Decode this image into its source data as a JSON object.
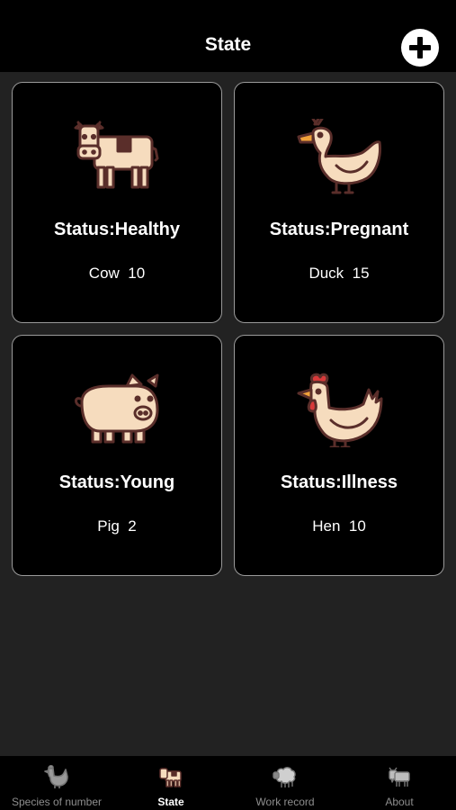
{
  "header": {
    "title": "State"
  },
  "colors": {
    "background": "#222222",
    "card_background": "#000000",
    "card_border": "#9a9a9a",
    "animal_fill": "#f6dcbe",
    "animal_outline": "#5a2e2a",
    "comb_red": "#d83a3a",
    "beak_orange": "#f2a23a"
  },
  "cards": [
    {
      "icon": "cow-icon",
      "status": "Status:Healthy",
      "animal": "Cow",
      "count": "10"
    },
    {
      "icon": "duck-icon",
      "status": "Status:Pregnant",
      "animal": "Duck",
      "count": "15"
    },
    {
      "icon": "pig-icon",
      "status": "Status:Young",
      "animal": "Pig",
      "count": "2"
    },
    {
      "icon": "hen-icon",
      "status": "Status:Illness",
      "animal": "Hen",
      "count": "10"
    }
  ],
  "tabs": [
    {
      "label": "Species of number",
      "icon": "hen-icon",
      "active": false
    },
    {
      "label": "State",
      "icon": "cow-icon",
      "active": true
    },
    {
      "label": "Work record",
      "icon": "sheep-icon",
      "active": false
    },
    {
      "label": "About",
      "icon": "goat-icon",
      "active": false
    }
  ]
}
